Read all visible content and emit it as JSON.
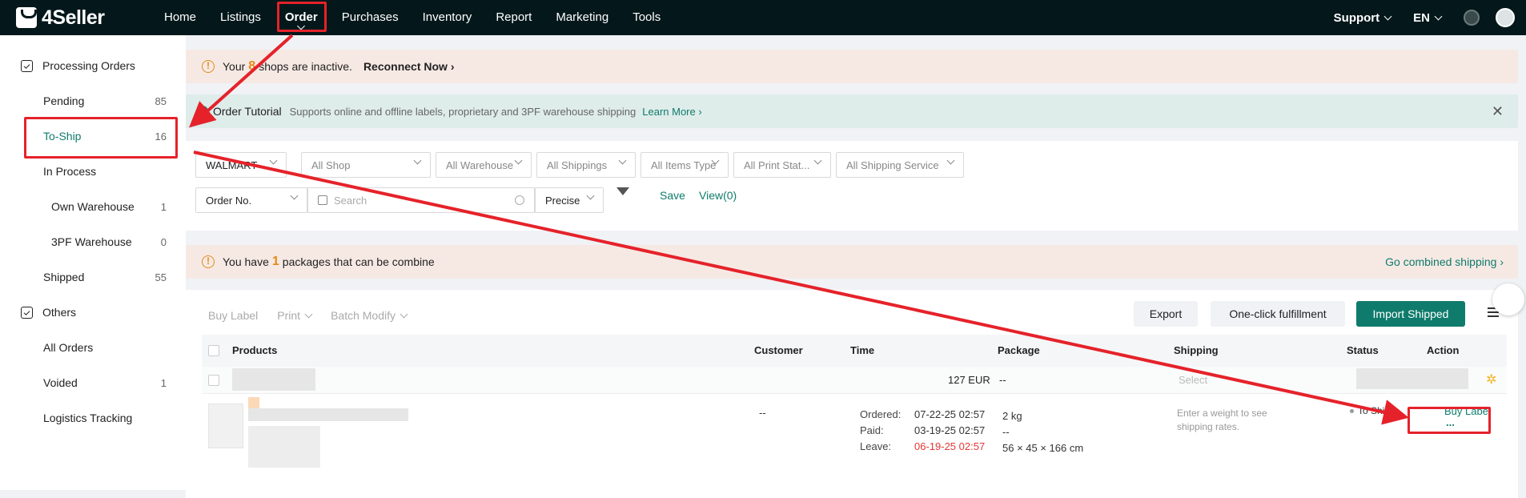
{
  "topbar": {
    "brand": "4Seller",
    "nav": [
      "Home",
      "Listings",
      "Order",
      "Purchases",
      "Inventory",
      "Report",
      "Marketing",
      "Tools"
    ],
    "active": "Order",
    "support": "Support",
    "lang": "EN"
  },
  "sidebar": {
    "group1": "Processing Orders",
    "items": [
      {
        "label": "Pending",
        "count": "85"
      },
      {
        "label": "To-Ship",
        "count": "16"
      },
      {
        "label": "In Process",
        "count": ""
      },
      {
        "label": "Own Warehouse",
        "count": "1"
      },
      {
        "label": "3PF Warehouse",
        "count": "0"
      },
      {
        "label": "Shipped",
        "count": "55"
      }
    ],
    "group2": "Others",
    "others": [
      {
        "label": "All Orders",
        "count": ""
      },
      {
        "label": "Voided",
        "count": "1"
      },
      {
        "label": "Logistics Tracking",
        "count": ""
      }
    ]
  },
  "banner_inactive": {
    "pre": "Your",
    "count": "8",
    "post": "shops are inactive.",
    "action": "Reconnect Now ›"
  },
  "tutorial": {
    "title": "Order Tutorial",
    "desc": "Supports online and offline labels, proprietary and 3PF warehouse shipping",
    "link": "Learn More ›"
  },
  "filters": {
    "platform": "WALMART",
    "shop": "All Shop",
    "warehouse": "All Warehouse",
    "shippings": "All Shippings",
    "items_type": "All Items Type",
    "print_status": "All Print Stat...",
    "shipping_service": "All Shipping Service",
    "search_field": "Order No.",
    "search_placeholder": "Search",
    "match": "Precise",
    "save": "Save",
    "view": "View(0)"
  },
  "banner_combine": {
    "pre": "You have",
    "count": "1",
    "post": "packages that can be combine",
    "link": "Go combined shipping ›"
  },
  "toolbar": {
    "buy_label": "Buy Label",
    "print": "Print",
    "batch": "Batch Modify",
    "export": "Export",
    "oneclick": "One-click fulfillment",
    "import": "Import Shipped"
  },
  "table": {
    "headers": {
      "products": "Products",
      "customer": "Customer",
      "time": "Time",
      "package": "Package",
      "shipping": "Shipping",
      "status": "Status",
      "action": "Action"
    },
    "group_row": {
      "amount": "127 EUR",
      "package": "--",
      "shipping_select": "Select"
    },
    "order": {
      "customer": "--",
      "ordered_label": "Ordered:",
      "ordered": "07-22-25 02:57",
      "paid_label": "Paid:",
      "paid": "03-19-25 02:57",
      "leave_label": "Leave:",
      "leave": "06-19-25 02:57",
      "weight": "2 kg",
      "pkg_line2": "--",
      "dims": "56 × 45 × 166 cm",
      "shipping_hint": "Enter a weight to see shipping rates.",
      "status": "To Ship",
      "action": "Buy Label",
      "more": "..."
    }
  },
  "colors": {
    "brand": "#0f7b6c",
    "annotation": "#e5222a",
    "warning": "#e68a1a"
  }
}
